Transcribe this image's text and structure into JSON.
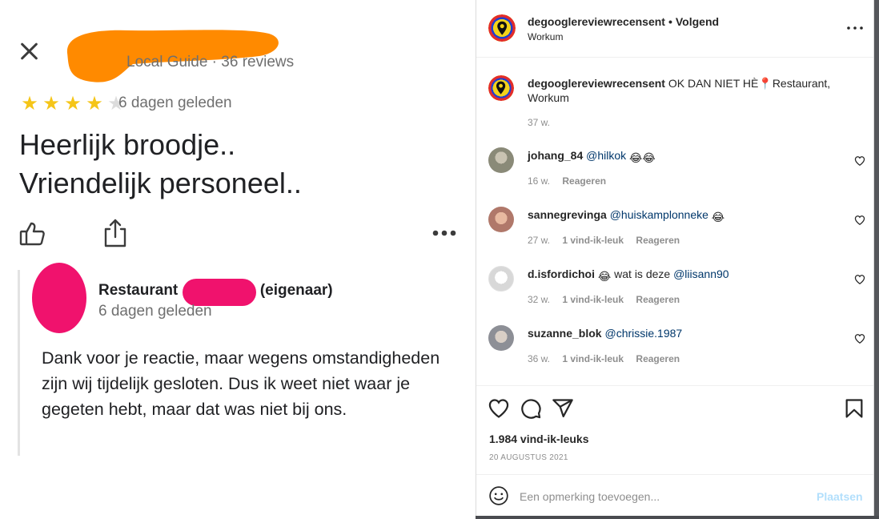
{
  "review": {
    "reviewer_meta": "Local Guide · 36 reviews",
    "rating": 4,
    "rating_max": 5,
    "date": "6 dagen geleden",
    "text": "Heerlijk broodje..\nVriendelijk personeel..",
    "owner_reply": {
      "name_prefix": "Restaurant",
      "name_suffix": "(eigenaar)",
      "date": "6 dagen geleden",
      "text": "Dank voor je reactie, maar wegens omstandigheden zijn wij tijdelijk gesloten. Dus ik weet niet waar je gegeten hebt, maar dat was niet bij ons."
    },
    "colors": {
      "star": "#f5c518",
      "redaction_orange": "#ff8a00",
      "redaction_pink": "#f0126d"
    }
  },
  "post": {
    "username": "degooglereviewrecensent",
    "separator": "•",
    "follow_status": "Volgend",
    "location": "Workum",
    "caption": {
      "username": "degooglereviewrecensent",
      "text": "OK DAN NIET HÈ📍Restaurant, Workum",
      "time": "37 w."
    },
    "comments": [
      {
        "user": "johang_84",
        "mention": "@hilkok",
        "middle": "",
        "emoji": "😂😂",
        "time": "16 w.",
        "likes": "",
        "reply": "Reageren"
      },
      {
        "user": "sannegrevinga",
        "mention": "@huiskamplonneke",
        "middle": "",
        "emoji": "😂",
        "time": "27 w.",
        "likes": "1 vind-ik-leuk",
        "reply": "Reageren"
      },
      {
        "user": "d.isfordichoi",
        "mention": "@liisann90",
        "middle": "wat is deze",
        "emoji": "😂",
        "time": "32 w.",
        "likes": "1 vind-ik-leuk",
        "reply": "Reageren"
      },
      {
        "user": "suzanne_blok",
        "mention": "@chrissie.1987",
        "middle": "",
        "emoji": "",
        "time": "36 w.",
        "likes": "1 vind-ik-leuk",
        "reply": "Reageren"
      }
    ],
    "likes": "1.984 vind-ik-leuks",
    "date": "20 AUGUSTUS 2021",
    "comment_placeholder": "Een opmerking toevoegen...",
    "post_button": "Plaatsen",
    "icons": [
      "heart-icon",
      "comment-icon",
      "share-icon",
      "bookmark-icon",
      "emoji-icon",
      "more-icon"
    ]
  }
}
